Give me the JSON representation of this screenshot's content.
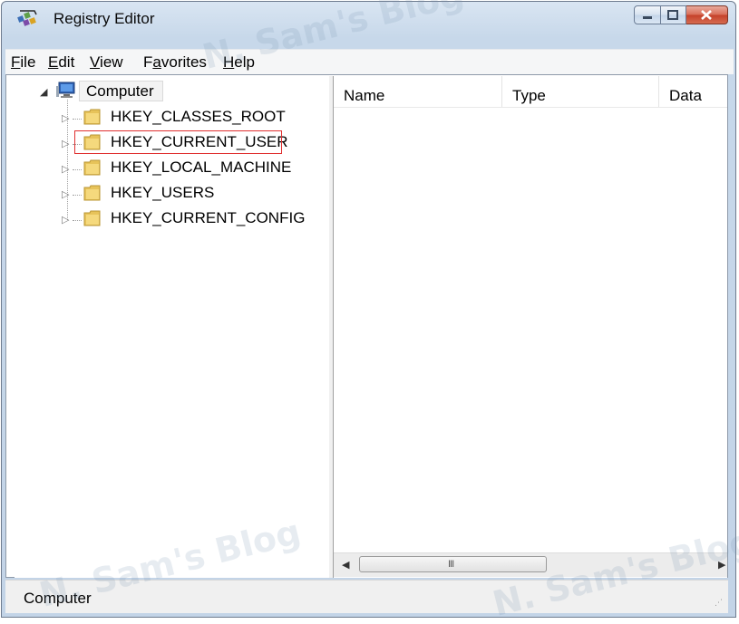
{
  "window": {
    "title": "Registry Editor"
  },
  "menu": [
    {
      "label_u": "F",
      "label_rest": "ile"
    },
    {
      "label_u": "E",
      "label_rest": "dit"
    },
    {
      "label_u": "V",
      "label_rest": "iew"
    },
    {
      "label_pre": "F",
      "label_u": "a",
      "label_rest": "vorites"
    },
    {
      "label_u": "H",
      "label_rest": "elp"
    }
  ],
  "tree": {
    "root": "Computer",
    "keys": [
      "HKEY_CLASSES_ROOT",
      "HKEY_CURRENT_USER",
      "HKEY_LOCAL_MACHINE",
      "HKEY_USERS",
      "HKEY_CURRENT_CONFIG"
    ]
  },
  "list": {
    "columns": [
      "Name",
      "Type",
      "Data"
    ]
  },
  "scrollbar": {
    "left_arrow": "◀",
    "right_arrow": "▶",
    "grip": "III"
  },
  "status": {
    "text": "Computer"
  },
  "watermark": "N. Sam's Blog",
  "colors": {
    "highlight_border": "#e03030",
    "title_bar": "#c7d8ea",
    "close_button": "#c4402a"
  }
}
